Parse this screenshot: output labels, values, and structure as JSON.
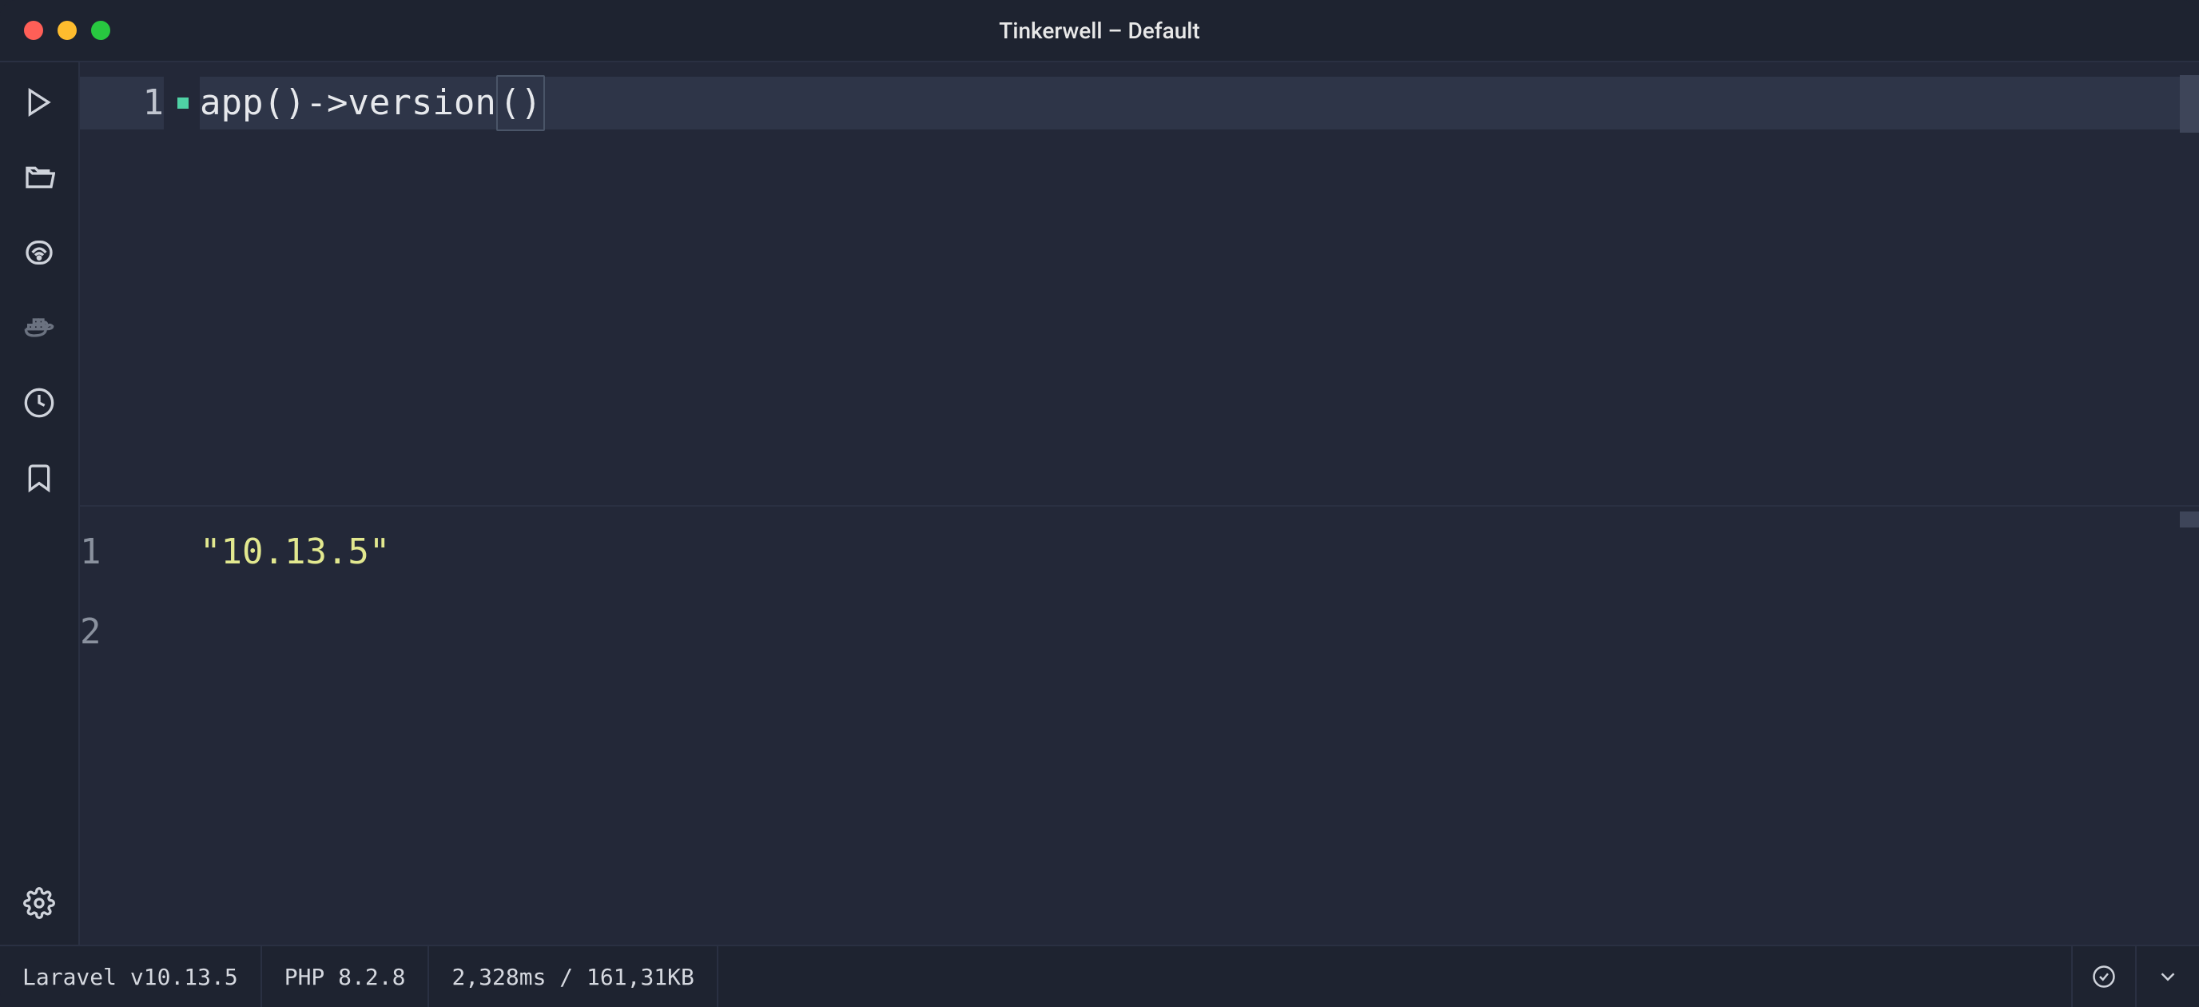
{
  "window": {
    "title": "Tinkerwell – Default"
  },
  "editor": {
    "lines": [
      {
        "number": "1",
        "content": "app()->version()",
        "current": true
      }
    ]
  },
  "output": {
    "lines": [
      {
        "number": "1",
        "content": "\"10.13.5\""
      },
      {
        "number": "2",
        "content": ""
      }
    ]
  },
  "statusbar": {
    "framework": "Laravel v10.13.5",
    "php": "PHP 8.2.8",
    "stats": "2,328ms / 161,31KB"
  }
}
